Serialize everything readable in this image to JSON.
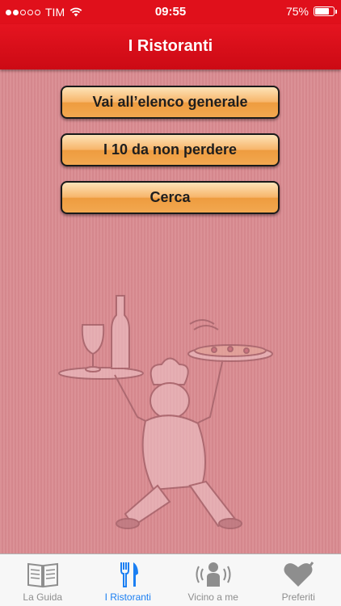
{
  "status_bar": {
    "carrier": "TIM",
    "time": "09:55",
    "battery_percent": "75%",
    "battery_level": 0.75,
    "signal_bars": 2,
    "signal_max": 5
  },
  "nav": {
    "title": "I Ristoranti"
  },
  "menu": {
    "buttons": [
      {
        "label": "Vai all’elenco generale"
      },
      {
        "label": "I 10 da non perdere"
      },
      {
        "label": "Cerca"
      }
    ]
  },
  "tabbar": {
    "active_index": 1,
    "active_color": "#1b7ff2",
    "inactive_color": "#8e8e8e",
    "items": [
      {
        "label": "La Guida",
        "icon": "book-icon"
      },
      {
        "label": "I Ristoranti",
        "icon": "fork-knife-icon"
      },
      {
        "label": "Vicino a me",
        "icon": "person-location-icon"
      },
      {
        "label": "Preferiti",
        "icon": "heart-pen-icon"
      }
    ]
  },
  "colors": {
    "header_red": "#e0101b",
    "background_pink": "#d98a90",
    "button_orange": "#f2a850"
  }
}
